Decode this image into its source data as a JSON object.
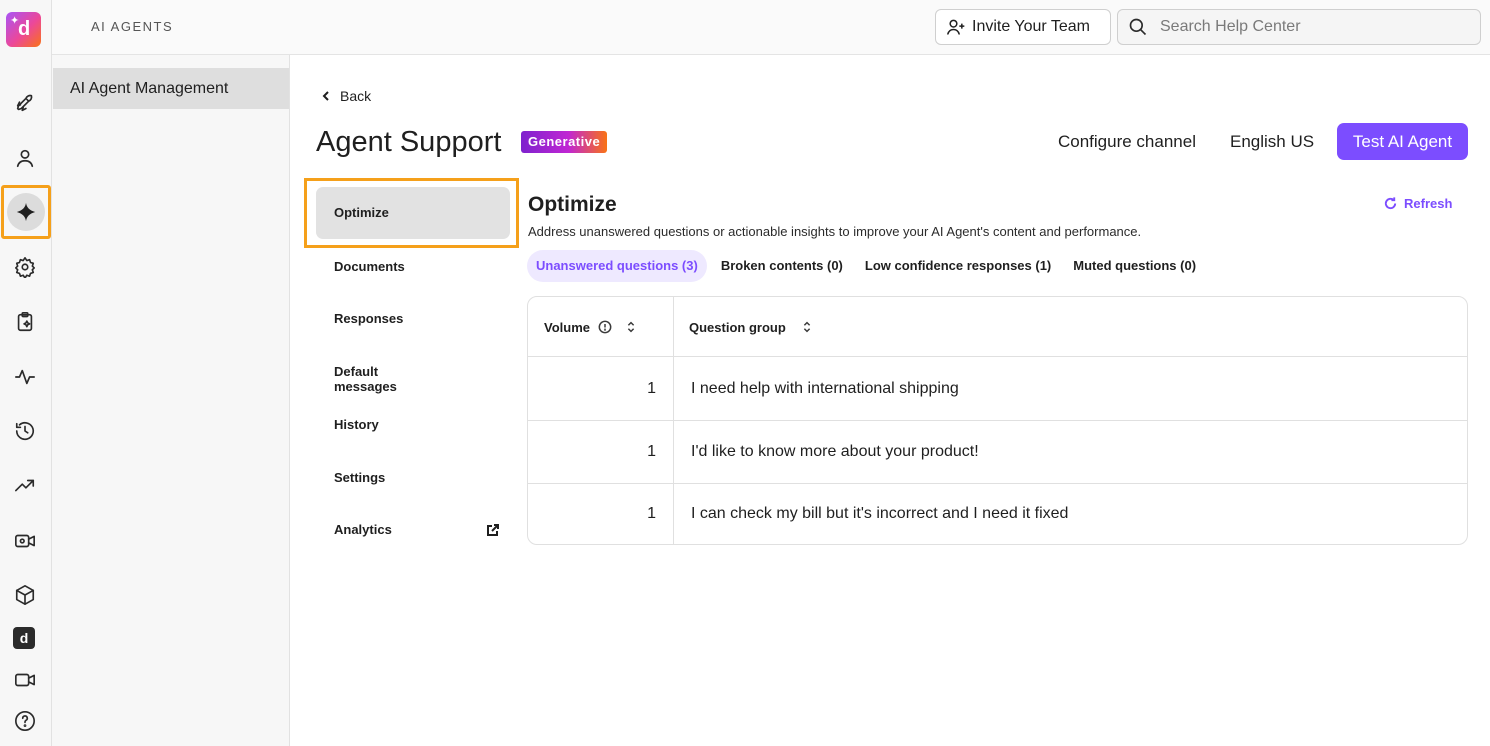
{
  "header": {
    "section_label": "AI AGENTS",
    "invite_label": "Invite Your Team",
    "search_placeholder": "Search Help Center"
  },
  "rail": {
    "items": [
      "logo",
      "rocket-icon",
      "person-icon",
      "sparkle-icon",
      "gear-icon",
      "clipboard-sparkle-icon",
      "activity-icon",
      "history-icon",
      "trending-up-icon",
      "video-settings-icon",
      "cube-icon",
      "d-app-icon",
      "video-icon",
      "help-icon"
    ],
    "active": "sparkle-icon"
  },
  "sidepanel": {
    "items": [
      {
        "label": "AI Agent Management"
      }
    ]
  },
  "page": {
    "back_label": "Back",
    "title": "Agent Support",
    "badge": "Generative",
    "configure_label": "Configure channel",
    "language_label": "English US",
    "test_label": "Test AI Agent"
  },
  "subnav": {
    "items": [
      {
        "label": "Optimize"
      },
      {
        "label": "Documents"
      },
      {
        "label": "Responses"
      },
      {
        "label": "Default messages"
      },
      {
        "label": "History"
      },
      {
        "label": "Settings"
      },
      {
        "label": "Analytics"
      }
    ],
    "active": "Optimize"
  },
  "optimize": {
    "title": "Optimize",
    "description": "Address unanswered questions or actionable insights to improve your AI Agent's content and performance.",
    "refresh_label": "Refresh",
    "tabs": [
      {
        "label": "Unanswered questions (3)"
      },
      {
        "label": "Broken contents (0)"
      },
      {
        "label": "Low confidence responses (1)"
      },
      {
        "label": "Muted questions (0)"
      }
    ]
  },
  "table": {
    "columns": [
      "Volume",
      "Question group"
    ],
    "rows": [
      {
        "volume": "1",
        "question": "I need help with international shipping"
      },
      {
        "volume": "1",
        "question": "I'd like to know more about your product!"
      },
      {
        "volume": "1",
        "question": "I can check my bill but it's incorrect and I need it fixed"
      }
    ]
  },
  "colors": {
    "accent": "#7c4dff",
    "highlight_frame": "#f5a01a"
  }
}
